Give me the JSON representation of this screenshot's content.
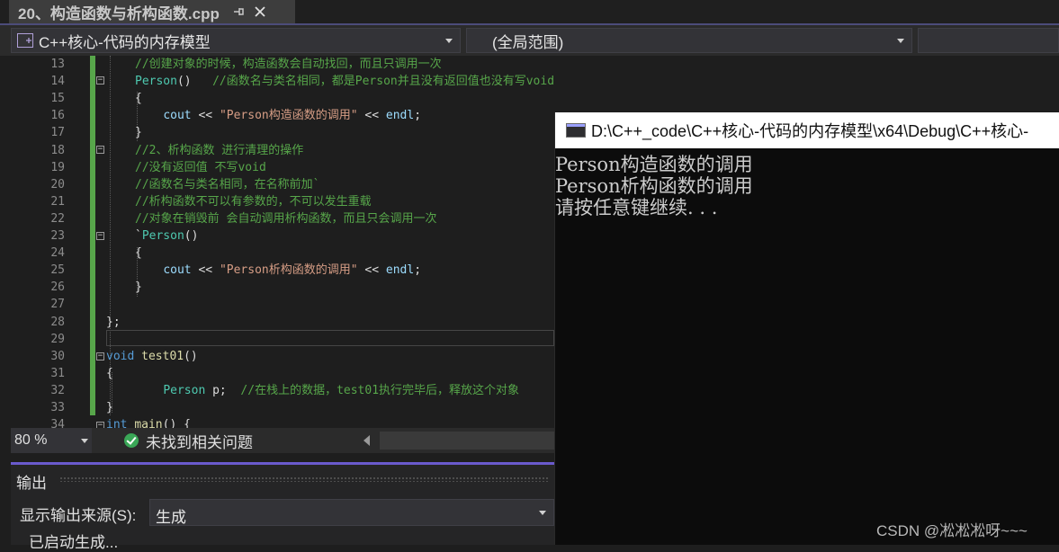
{
  "tab": {
    "title": "20、构造函数与析构函数.cpp",
    "pin_icon": "pin-icon",
    "close_icon": "close-icon"
  },
  "navbar": {
    "project": "C++核心-代码的内存模型",
    "scope": "(全局范围)",
    "third": ""
  },
  "editor": {
    "lines": [
      {
        "num": "13",
        "text": "//创建对象的时候，构造函数会自动找回，而且只调用一次"
      },
      {
        "num": "14",
        "text": "Person()   //函数名与类名相同，都是Person并且没有返回值也没有写void"
      },
      {
        "num": "15",
        "text": "{"
      },
      {
        "num": "16",
        "text": "    cout << \"Person构造函数的调用\" << endl;"
      },
      {
        "num": "17",
        "text": "}"
      },
      {
        "num": "18",
        "text": "//2、析构函数 进行清理的操作"
      },
      {
        "num": "19",
        "text": "//没有返回值 不写void"
      },
      {
        "num": "20",
        "text": "//函数名与类名相同，在名称前加`"
      },
      {
        "num": "21",
        "text": "//析构函数不可以有参数的，不可以发生重载"
      },
      {
        "num": "22",
        "text": "//对象在销毁前 会自动调用析构函数，而且只会调用一次"
      },
      {
        "num": "23",
        "text": "`Person()"
      },
      {
        "num": "24",
        "text": "{"
      },
      {
        "num": "25",
        "text": "    cout << \"Person析构函数的调用\" << endl;"
      },
      {
        "num": "26",
        "text": "}"
      },
      {
        "num": "27",
        "text": ""
      },
      {
        "num": "28",
        "text": "};"
      },
      {
        "num": "29",
        "text": ""
      },
      {
        "num": "30",
        "text": "void test01()"
      },
      {
        "num": "31",
        "text": "{"
      },
      {
        "num": "32",
        "text": "    Person p;  //在栈上的数据，test01执行完毕后，释放这个对象"
      },
      {
        "num": "33",
        "text": "}"
      },
      {
        "num": "34",
        "text": "int main() {"
      }
    ]
  },
  "statusbar": {
    "zoom": "80 %",
    "issues": "未找到相关问题"
  },
  "output": {
    "title": "输出",
    "source_label": "显示输出来源(S):",
    "source_value": "生成",
    "line1": "已启动生成..."
  },
  "console": {
    "title": "D:\\C++_code\\C++核心-代码的内存模型\\x64\\Debug\\C++核心-",
    "lines": [
      "Person构造函数的调用",
      "Person析构函数的调用",
      "请按任意键继续. . ."
    ]
  },
  "watermark": "CSDN @凇凇凇呀~~~"
}
